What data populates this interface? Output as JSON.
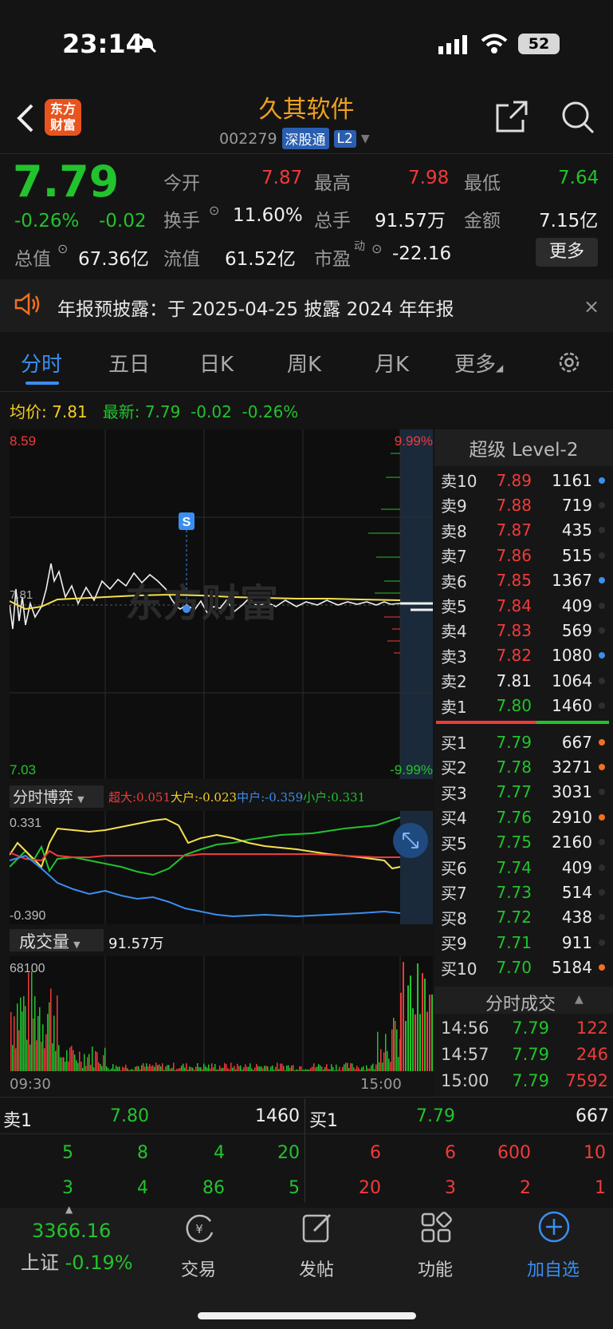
{
  "status_bar": {
    "time": "23:14",
    "battery": "52"
  },
  "header": {
    "logo": "东方财富",
    "title": "久其软件",
    "code": "002279",
    "badge_sgt": "深股通",
    "badge_l2": "L2"
  },
  "quote": {
    "price": "7.79",
    "change_pct": "-0.26%",
    "change": "-0.02",
    "open_label": "今开",
    "open": "7.87",
    "high_label": "最高",
    "high": "7.98",
    "low_label": "最低",
    "low": "7.64",
    "turnover_label": "换手",
    "turnover": "11.60%",
    "volume_label": "总手",
    "volume": "91.57万",
    "amount_label": "金额",
    "amount": "7.15亿",
    "mktcap_label": "总值",
    "mktcap": "67.36亿",
    "float_label": "流值",
    "float": "61.52亿",
    "pe_label": "市盈",
    "pe_sup": "动",
    "pe": "-22.16",
    "more": "更多"
  },
  "notice": {
    "text": "年报预披露：于 2025-04-25 披露 2024 年年报"
  },
  "tabs": [
    "分时",
    "五日",
    "日K",
    "周K",
    "月K",
    "更多"
  ],
  "info_line": {
    "avg_label": "均价:",
    "avg": "7.81",
    "latest_label": "最新:",
    "latest": "7.79",
    "chg": "-0.02",
    "pct": "-0.26%"
  },
  "intraday": {
    "y_top": "8.59",
    "y_bottom": "7.03",
    "pct_top": "9.99%",
    "pct_bottom": "-9.99%",
    "mid_label": "7.81",
    "marker": "S",
    "watermark": "东方财富",
    "time_start": "09:30",
    "time_end": "15:00"
  },
  "game": {
    "label": "分时博弈",
    "super": "超大:0.051",
    "large": "大户:-0.023",
    "mid": "中户:-0.359",
    "small": "小户:0.331",
    "y_top": "0.331",
    "y_bottom": "-0.390"
  },
  "volume": {
    "label": "成交量",
    "total": "91.57万",
    "y_top": "68100"
  },
  "level2": {
    "title": "超级 Level-2",
    "sells": [
      {
        "label": "卖10",
        "price": "7.89",
        "vol": "1161",
        "dot": "#3a8ef0"
      },
      {
        "label": "卖9",
        "price": "7.88",
        "vol": "719",
        "dot": ""
      },
      {
        "label": "卖8",
        "price": "7.87",
        "vol": "435",
        "dot": ""
      },
      {
        "label": "卖7",
        "price": "7.86",
        "vol": "515",
        "dot": ""
      },
      {
        "label": "卖6",
        "price": "7.85",
        "vol": "1367",
        "dot": "#3a8ef0"
      },
      {
        "label": "卖5",
        "price": "7.84",
        "vol": "409",
        "dot": ""
      },
      {
        "label": "卖4",
        "price": "7.83",
        "vol": "569",
        "dot": ""
      },
      {
        "label": "卖3",
        "price": "7.82",
        "vol": "1080",
        "dot": "#3a8ef0"
      },
      {
        "label": "卖2",
        "price": "7.81",
        "vol": "1064",
        "dot": ""
      },
      {
        "label": "卖1",
        "price": "7.80",
        "vol": "1460",
        "dot": ""
      }
    ],
    "buys": [
      {
        "label": "买1",
        "price": "7.79",
        "vol": "667",
        "dot": "#f07020"
      },
      {
        "label": "买2",
        "price": "7.78",
        "vol": "3271",
        "dot": "#f07020"
      },
      {
        "label": "买3",
        "price": "7.77",
        "vol": "3031",
        "dot": ""
      },
      {
        "label": "买4",
        "price": "7.76",
        "vol": "2910",
        "dot": "#f07020"
      },
      {
        "label": "买5",
        "price": "7.75",
        "vol": "2160",
        "dot": ""
      },
      {
        "label": "买6",
        "price": "7.74",
        "vol": "409",
        "dot": ""
      },
      {
        "label": "买7",
        "price": "7.73",
        "vol": "514",
        "dot": ""
      },
      {
        "label": "买8",
        "price": "7.72",
        "vol": "438",
        "dot": ""
      },
      {
        "label": "买9",
        "price": "7.71",
        "vol": "911",
        "dot": ""
      },
      {
        "label": "买10",
        "price": "7.70",
        "vol": "5184",
        "dot": "#f07020"
      }
    ],
    "ticks_title": "分时成交",
    "ticks": [
      {
        "time": "14:56",
        "price": "7.79",
        "vol": "122"
      },
      {
        "time": "14:57",
        "price": "7.79",
        "vol": "246"
      },
      {
        "time": "15:00",
        "price": "7.79",
        "vol": "7592"
      }
    ]
  },
  "bottom_detail": {
    "sell_label": "卖1",
    "sell_price": "7.80",
    "sell_vol": "1460",
    "buy_label": "买1",
    "buy_price": "7.79",
    "buy_vol": "667",
    "sell_q1": [
      "5",
      "8",
      "4",
      "20"
    ],
    "sell_q2": [
      "3",
      "4",
      "86",
      "5"
    ],
    "buy_q1": [
      "6",
      "6",
      "600",
      "10"
    ],
    "buy_q2": [
      "20",
      "3",
      "2",
      "1"
    ]
  },
  "nav": {
    "index_value": "3366.16",
    "index_name": "上证",
    "index_pct": "-0.19%",
    "trade": "交易",
    "post": "发帖",
    "func": "功能",
    "watch": "加自选"
  },
  "colors": {
    "up": "#f23a3a",
    "down": "#22c32d",
    "accent": "#3a8ef0",
    "avg_line": "#f5e050"
  }
}
